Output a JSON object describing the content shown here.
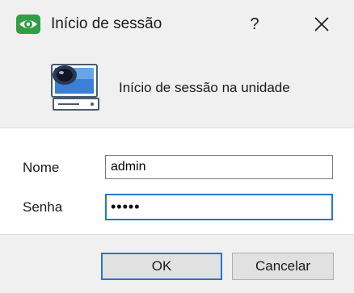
{
  "window": {
    "title": "Início de sessão",
    "help_label": "?",
    "app_icon": "eye-icon",
    "close_icon": "close-icon"
  },
  "header": {
    "icon": "computer-icon",
    "text": "Início de sessão na unidade"
  },
  "form": {
    "username_label": "Nome",
    "username_value": "admin",
    "password_label": "Senha",
    "password_value": "•••••"
  },
  "buttons": {
    "ok_label": "OK",
    "cancel_label": "Cancelar"
  },
  "colors": {
    "accent": "#1f78d1",
    "brand_green": "#2f9e44",
    "background": "#f0f0f0"
  }
}
